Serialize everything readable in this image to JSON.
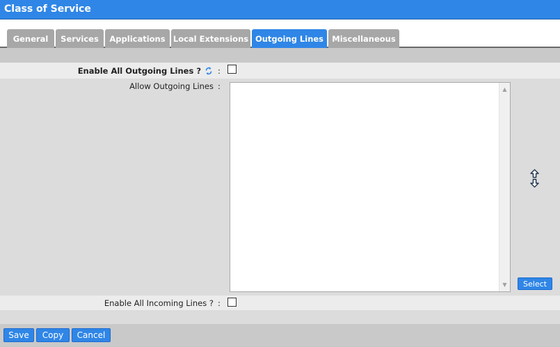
{
  "window": {
    "title": "Class of Service"
  },
  "tabs": [
    {
      "label": "General",
      "active": false
    },
    {
      "label": "Services",
      "active": false
    },
    {
      "label": "Applications",
      "active": false
    },
    {
      "label": "Local Extensions",
      "active": false
    },
    {
      "label": "Outgoing Lines",
      "active": true
    },
    {
      "label": "Miscellaneous",
      "active": false
    }
  ],
  "form": {
    "enable_outgoing": {
      "label": "Enable All Outgoing Lines ?",
      "colon": ":",
      "checked": false,
      "icon": "refresh-icon"
    },
    "allow_outgoing": {
      "label": "Allow Outgoing Lines",
      "colon": ":",
      "items": []
    },
    "select_button": "Select",
    "enable_incoming": {
      "label": "Enable All Incoming Lines ?",
      "colon": ":",
      "checked": false
    }
  },
  "footer": {
    "save": "Save",
    "copy": "Copy",
    "cancel": "Cancel"
  },
  "colors": {
    "accent": "#2f86e6",
    "tab_inactive": "#a7a7a7"
  }
}
